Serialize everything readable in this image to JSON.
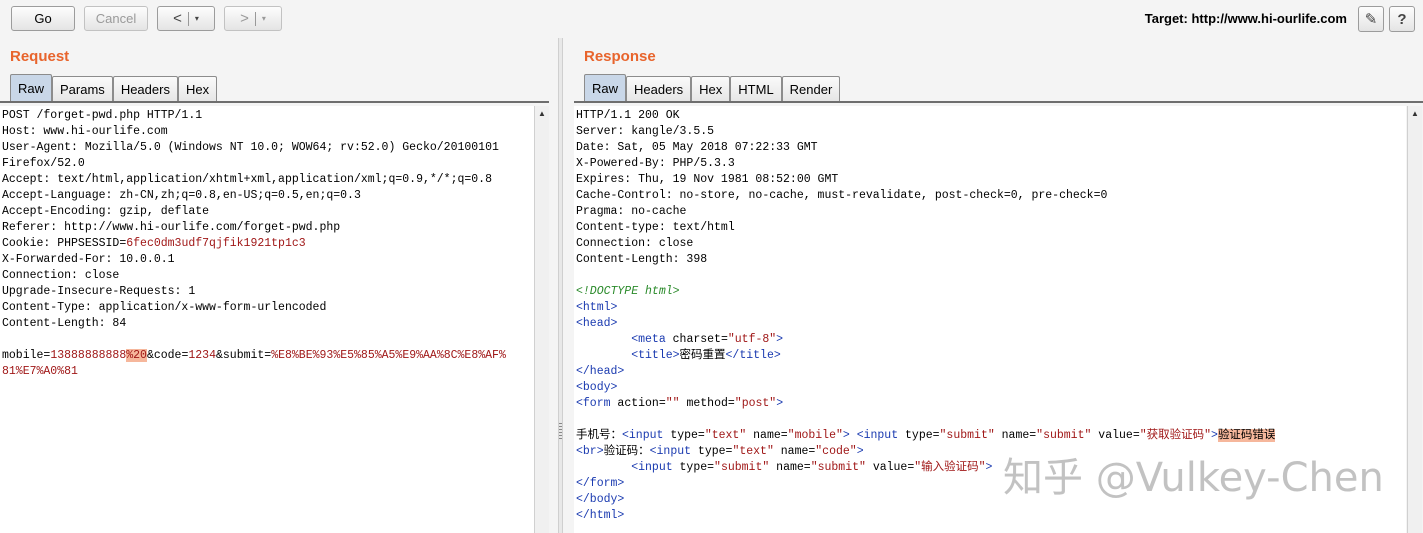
{
  "toolbar": {
    "go": "Go",
    "cancel": "Cancel",
    "back": "<",
    "forward": ">",
    "dropdown": "▾",
    "target_label": "Target:",
    "target_url": "http://www.hi-ourlife.com",
    "edit_icon": "✎",
    "help_icon": "?"
  },
  "request": {
    "title": "Request",
    "tabs": [
      "Raw",
      "Params",
      "Headers",
      "Hex"
    ],
    "active_tab": "Raw",
    "headers": [
      "POST /forget-pwd.php HTTP/1.1",
      "Host: www.hi-ourlife.com",
      "User-Agent: Mozilla/5.0 (Windows NT 10.0; WOW64; rv:52.0) Gecko/20100101",
      "Firefox/52.0",
      "Accept: text/html,application/xhtml+xml,application/xml;q=0.9,*/*;q=0.8",
      "Accept-Language: zh-CN,zh;q=0.8,en-US;q=0.5,en;q=0.3",
      "Accept-Encoding: gzip, deflate",
      "Referer: http://www.hi-ourlife.com/forget-pwd.php"
    ],
    "cookie_key": "Cookie: PHPSESSID=",
    "cookie_val": "6fec0dm3udf7qjfik1921tp1c3",
    "headers2": [
      "X-Forwarded-For: 10.0.0.1",
      "Connection: close",
      "Upgrade-Insecure-Requests: 1",
      "Content-Type: application/x-www-form-urlencoded",
      "Content-Length: 84"
    ],
    "body": {
      "p1": "mobile=",
      "v1": "13888888888",
      "hl": "%20",
      "p2": "&code=",
      "v2": "1234",
      "p3": "&submit=",
      "v3": "%E8%BE%93%E5%85%A5%E9%AA%8C%E8%AF%",
      "v4": "81%E7%A0%81"
    }
  },
  "response": {
    "title": "Response",
    "tabs": [
      "Raw",
      "Headers",
      "Hex",
      "HTML",
      "Render"
    ],
    "active_tab": "Raw",
    "headers": [
      "HTTP/1.1 200 OK",
      "Server: kangle/3.5.5",
      "Date: Sat, 05 May 2018 07:22:33 GMT",
      "X-Powered-By: PHP/5.3.3",
      "Expires: Thu, 19 Nov 1981 08:52:00 GMT",
      "Cache-Control: no-store, no-cache, must-revalidate, post-check=0, pre-check=0",
      "Pragma: no-cache",
      "Content-type: text/html",
      "Connection: close",
      "Content-Length: 398"
    ],
    "html": {
      "doctype": "<!DOCTYPE html>",
      "html_open": "<html>",
      "head_open": "<head>",
      "meta_a": "<meta ",
      "meta_attr": "charset",
      "meta_val": "\"utf-8\"",
      "meta_b": ">",
      "title_open": "<title>",
      "title_text": "密码重置",
      "title_close": "</title>",
      "head_close": "</head>",
      "body_open": "<body>",
      "form_a": "<form ",
      "form_attr1": "action",
      "form_val1": "\"\"",
      "form_attr2": "method",
      "form_val2": "\"post\"",
      "form_b": ">",
      "mobile_label": "手机号：",
      "input1_a": "<input ",
      "input1_attr1": "type",
      "input1_val1": "\"text\"",
      "input1_attr2": "name",
      "input1_val2": "\"mobile\"",
      "input1_b": ">",
      "input2_a": "<input ",
      "input2_attr1": "type",
      "input2_val1": "\"submit\"",
      "input2_attr2": "name",
      "input2_val2": "\"submit\"",
      "input2_attr3": "value",
      "input2_val3": "\"获取验证码\"",
      "input2_b": ">",
      "error_text": "验证码错误",
      "br": "<br>",
      "code_label": "验证码：",
      "input3_a": "<input ",
      "input3_attr1": "type",
      "input3_val1": "\"text\"",
      "input3_attr2": "name",
      "input3_val2": "\"code\"",
      "input3_b": ">",
      "input4_a": "<input ",
      "input4_attr1": "type",
      "input4_val1": "\"submit\"",
      "input4_attr2": "name",
      "input4_val2": "\"submit\"",
      "input4_attr3": "value",
      "input4_val3": "\"输入验证码\"",
      "input4_b": ">",
      "form_close": "</form>",
      "body_close": "</body>",
      "html_close": "</html>"
    }
  },
  "watermark": "知乎 @Vulkey-Chen"
}
